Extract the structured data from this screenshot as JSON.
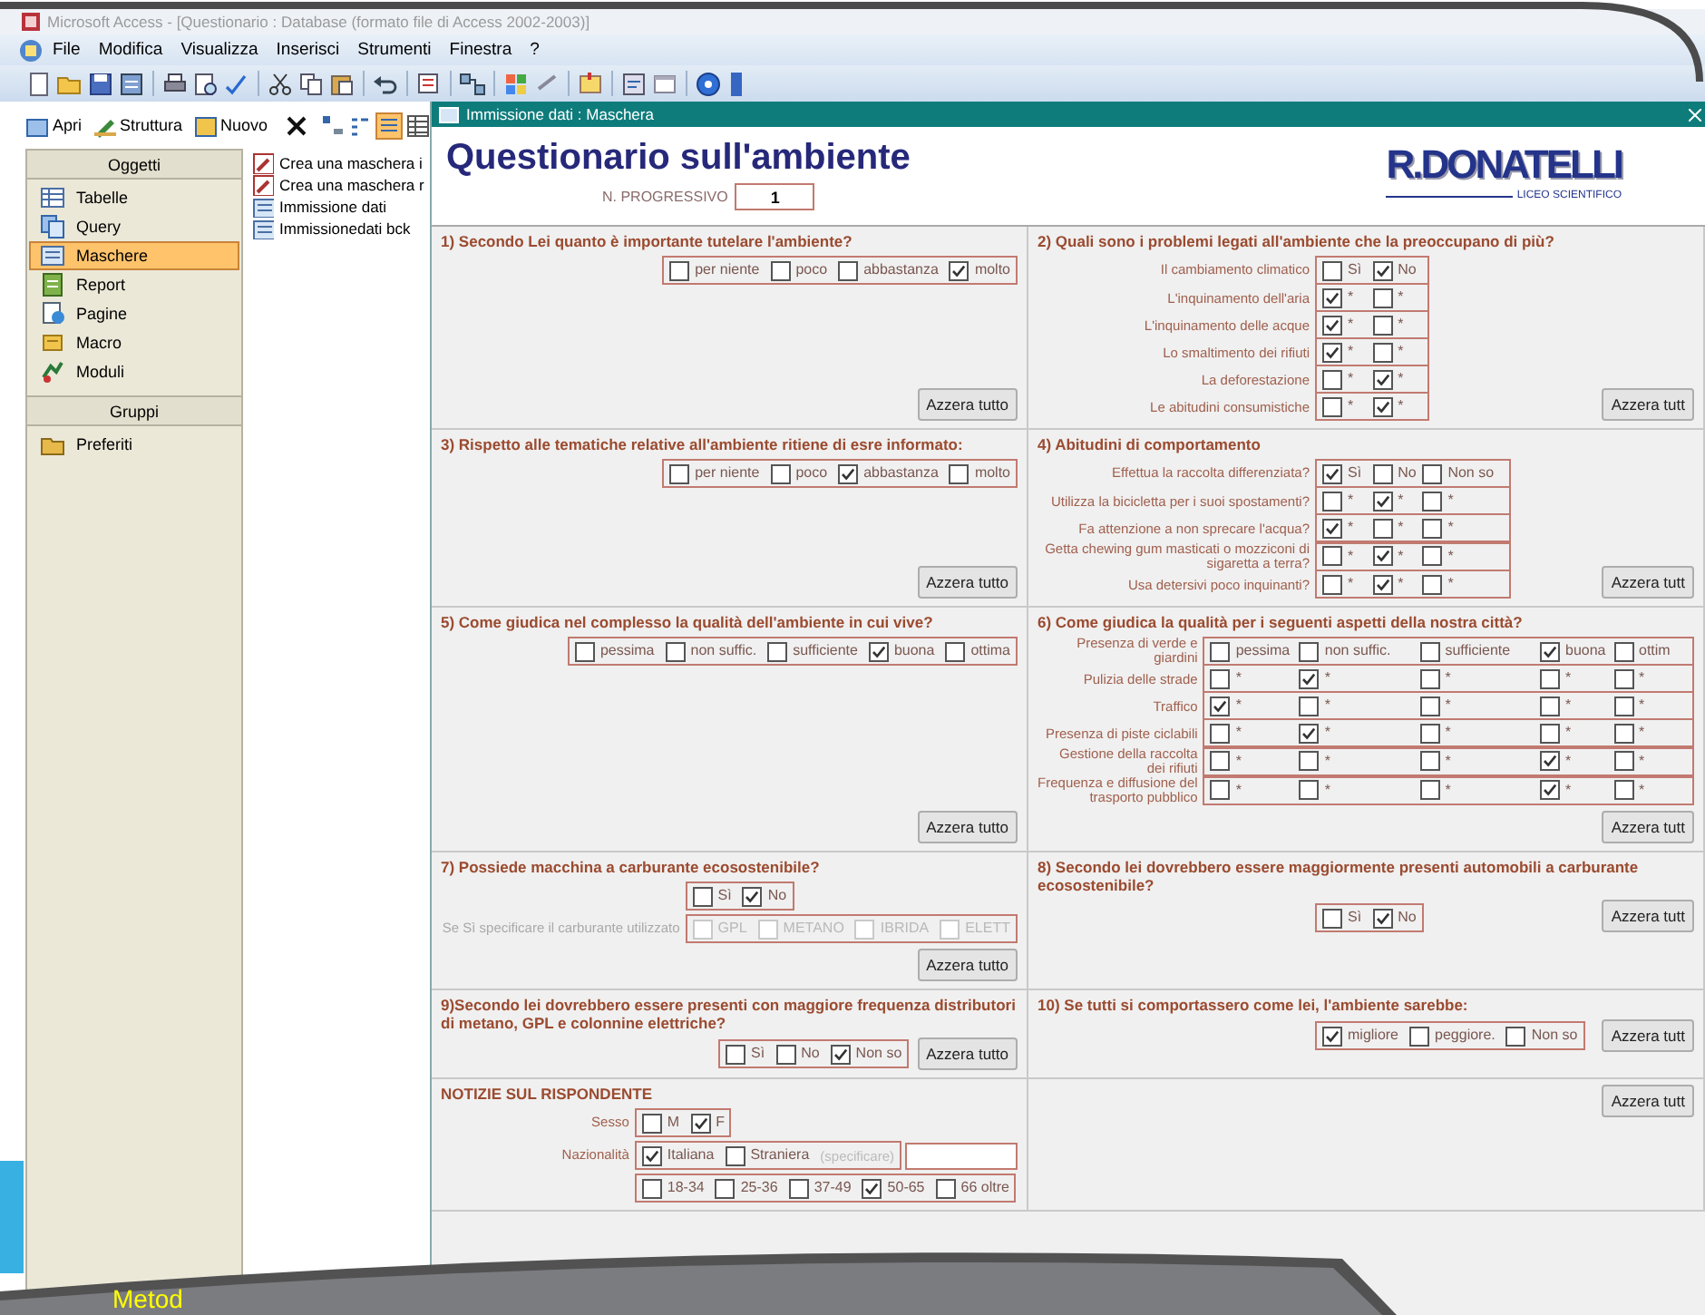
{
  "app": {
    "title": "Microsoft Access - [Questionario : Database (formato file di Access 2002-2003)]"
  },
  "menu": [
    "File",
    "Modifica",
    "Visualizza",
    "Inserisci",
    "Strumenti",
    "Finestra",
    "?"
  ],
  "db_toolbar": [
    "Apri",
    "Struttura",
    "Nuovo"
  ],
  "sidebar": {
    "header": "Oggetti",
    "items": [
      {
        "label": "Tabelle",
        "kind": "table",
        "selected": false
      },
      {
        "label": "Query",
        "kind": "query",
        "selected": false
      },
      {
        "label": "Maschere",
        "kind": "form",
        "selected": true
      },
      {
        "label": "Report",
        "kind": "report",
        "selected": false
      },
      {
        "label": "Pagine",
        "kind": "page",
        "selected": false
      },
      {
        "label": "Macro",
        "kind": "macro",
        "selected": false
      },
      {
        "label": "Moduli",
        "kind": "module",
        "selected": false
      }
    ],
    "groups_header": "Gruppi",
    "groups": [
      {
        "label": "Preferiti",
        "kind": "folder",
        "selected": false
      }
    ]
  },
  "objects": [
    {
      "label": "Crea una maschera i",
      "kind": "wizard"
    },
    {
      "label": "Crea una maschera r",
      "kind": "wizard"
    },
    {
      "label": "Immissione dati",
      "kind": "form"
    },
    {
      "label": "Immissionedati bck",
      "kind": "form"
    }
  ],
  "form": {
    "window_title": "Immissione dati : Maschera",
    "title": "Questionario sull'ambiente",
    "progressivo": {
      "label": "N. PROGRESSIVO",
      "value": "1"
    },
    "logo": {
      "name": "R.DONATELLI",
      "subtitle": "LICEO SCIENTIFICO"
    },
    "sections": [
      {
        "kind": "block",
        "question": "1) Secondo Lei quanto è importante tutelare l'ambiente?",
        "groups": [
          {
            "options": [
              {
                "label": "per niente",
                "checked": false
              },
              {
                "label": "poco",
                "checked": false
              },
              {
                "label": "abbastanza",
                "checked": false
              },
              {
                "label": "molto",
                "checked": true
              }
            ]
          }
        ],
        "reset": "Azzera tutto"
      },
      {
        "kind": "matrix",
        "question": "2) Quali sono i problemi legati all'ambiente che la preoccupano di più?",
        "groups": [
          {
            "label": "Il cambiamento climatico",
            "options": [
              {
                "label": "Sì",
                "checked": false
              },
              {
                "label": "No",
                "checked": true
              }
            ]
          },
          {
            "label": "L'inquinamento dell'aria",
            "options": [
              {
                "label": "*",
                "checked": true
              },
              {
                "label": "*",
                "checked": false
              }
            ]
          },
          {
            "label": "L'inquinamento delle acque",
            "options": [
              {
                "label": "*",
                "checked": true
              },
              {
                "label": "*",
                "checked": false
              }
            ]
          },
          {
            "label": "Lo smaltimento dei rifiuti",
            "options": [
              {
                "label": "*",
                "checked": true
              },
              {
                "label": "*",
                "checked": false
              }
            ]
          },
          {
            "label": "La deforestazione",
            "options": [
              {
                "label": "*",
                "checked": false
              },
              {
                "label": "*",
                "checked": true
              }
            ]
          },
          {
            "label": "Le abitudini consumistiche",
            "options": [
              {
                "label": "*",
                "checked": false
              },
              {
                "label": "*",
                "checked": true
              }
            ]
          }
        ],
        "reset": "Azzera tutt"
      },
      {
        "kind": "block",
        "question": "3) Rispetto alle tematiche relative all'ambiente ritiene di esre informato:",
        "groups": [
          {
            "options": [
              {
                "label": "per niente",
                "checked": false
              },
              {
                "label": "poco",
                "checked": false
              },
              {
                "label": "abbastanza",
                "checked": true
              },
              {
                "label": "molto",
                "checked": false
              }
            ]
          }
        ],
        "reset": "Azzera tutto"
      },
      {
        "kind": "matrix",
        "question": "4) Abitudini di comportamento",
        "groups": [
          {
            "label": "Effettua la raccolta differenziata?",
            "options": [
              {
                "label": "Sì",
                "checked": true
              },
              {
                "label": "No",
                "checked": false
              },
              {
                "label": "Non so",
                "checked": false
              }
            ]
          },
          {
            "label": "Utilizza la bicicletta per i suoi spostamenti?",
            "options": [
              {
                "label": "*",
                "checked": false
              },
              {
                "label": "*",
                "checked": true
              },
              {
                "label": "*",
                "checked": false
              }
            ]
          },
          {
            "label": "Fa attenzione a non sprecare l'acqua?",
            "options": [
              {
                "label": "*",
                "checked": true
              },
              {
                "label": "*",
                "checked": false
              },
              {
                "label": "*",
                "checked": false
              }
            ]
          },
          {
            "label": "Getta chewing gum masticati o mozziconi di sigaretta a terra?",
            "options": [
              {
                "label": "*",
                "checked": false
              },
              {
                "label": "*",
                "checked": true
              },
              {
                "label": "*",
                "checked": false
              }
            ]
          },
          {
            "label": "Usa detersivi poco inquinanti?",
            "options": [
              {
                "label": "*",
                "checked": false
              },
              {
                "label": "*",
                "checked": true
              },
              {
                "label": "*",
                "checked": false
              }
            ]
          }
        ],
        "reset": "Azzera tutt"
      },
      {
        "kind": "block",
        "question": "5) Come giudica nel complesso la qualità dell'ambiente in cui vive?",
        "groups": [
          {
            "options": [
              {
                "label": "pessima",
                "checked": false
              },
              {
                "label": "non suffic.",
                "checked": false
              },
              {
                "label": "sufficiente",
                "checked": false
              },
              {
                "label": "buona",
                "checked": true
              },
              {
                "label": "ottima",
                "checked": false
              }
            ]
          }
        ],
        "reset": "Azzera tutto"
      },
      {
        "kind": "matrix",
        "question": "6) Come giudica la qualità per i seguenti aspetti della nostra città?",
        "groups": [
          {
            "label": "Presenza di verde e giardini",
            "options": [
              {
                "label": "pessima",
                "checked": false
              },
              {
                "label": "non suffic.",
                "checked": false
              },
              {
                "label": "sufficiente",
                "checked": false
              },
              {
                "label": "buona",
                "checked": true
              },
              {
                "label": "ottim",
                "checked": false
              }
            ]
          },
          {
            "label": "Pulizia delle strade",
            "options": [
              {
                "label": "*",
                "checked": false
              },
              {
                "label": "*",
                "checked": true
              },
              {
                "label": "*",
                "checked": false
              },
              {
                "label": "*",
                "checked": false
              },
              {
                "label": "*",
                "checked": false
              }
            ]
          },
          {
            "label": "Traffico",
            "options": [
              {
                "label": "*",
                "checked": true
              },
              {
                "label": "*",
                "checked": false
              },
              {
                "label": "*",
                "checked": false
              },
              {
                "label": "*",
                "checked": false
              },
              {
                "label": "*",
                "checked": false
              }
            ]
          },
          {
            "label": "Presenza di piste ciclabili",
            "options": [
              {
                "label": "*",
                "checked": false
              },
              {
                "label": "*",
                "checked": true
              },
              {
                "label": "*",
                "checked": false
              },
              {
                "label": "*",
                "checked": false
              },
              {
                "label": "*",
                "checked": false
              }
            ]
          },
          {
            "label": "Gestione della raccolta dei rifiuti",
            "options": [
              {
                "label": "*",
                "checked": false
              },
              {
                "label": "*",
                "checked": false
              },
              {
                "label": "*",
                "checked": false
              },
              {
                "label": "*",
                "checked": true
              },
              {
                "label": "*",
                "checked": false
              }
            ]
          },
          {
            "label": "Frequenza e diffusione del trasporto pubblico",
            "options": [
              {
                "label": "*",
                "checked": false
              },
              {
                "label": "*",
                "checked": false
              },
              {
                "label": "*",
                "checked": false
              },
              {
                "label": "*",
                "checked": true
              },
              {
                "label": "*",
                "checked": false
              }
            ]
          }
        ],
        "reset": "Azzera tutt"
      },
      {
        "kind": "block",
        "question": "7) Possiede macchina a carburante ecosostenibile?",
        "groups": [
          {
            "disabled": false,
            "options": [
              {
                "label": "Sì",
                "checked": false
              },
              {
                "label": "No",
                "checked": true
              }
            ]
          },
          {
            "disabled": true,
            "label": "Se Sì specificare il carburante utilizzato",
            "options": [
              {
                "label": "GPL",
                "checked": false
              },
              {
                "label": "METANO",
                "checked": false
              },
              {
                "label": "IBRIDA",
                "checked": false
              },
              {
                "label": "ELETT",
                "checked": false
              }
            ]
          }
        ],
        "reset": "Azzera tutto"
      },
      {
        "kind": "block",
        "question": "8) Secondo lei dovrebbero essere maggiormente presenti automobili a carburante ecosostenibile?",
        "groups": [
          {
            "options": [
              {
                "label": "Sì",
                "checked": false
              },
              {
                "label": "No",
                "checked": true
              }
            ]
          }
        ],
        "reset": "Azzera tutt"
      },
      {
        "kind": "inline",
        "question": "9)Secondo lei dovrebbero essere presenti con maggiore frequenza distributori di metano, GPL e colonnine elettriche?",
        "groups": [
          {
            "options": [
              {
                "label": "Sì",
                "checked": false
              },
              {
                "label": "No",
                "checked": false
              },
              {
                "label": "Non so",
                "checked": true
              }
            ]
          }
        ],
        "reset": "Azzera tutto"
      },
      {
        "kind": "inline",
        "question": "10) Se tutti si comportassero come lei, l'ambiente sarebbe:",
        "groups": [
          {
            "options": [
              {
                "label": "migliore",
                "checked": true
              },
              {
                "label": "peggiore.",
                "checked": false
              },
              {
                "label": "Non so",
                "checked": false
              }
            ]
          }
        ],
        "reset": "Azzera tutt"
      },
      {
        "kind": "block",
        "question": "NOTIZIE SUL RISPONDENTE",
        "groups": [
          {
            "label": "Sesso",
            "options": [
              {
                "label": "M",
                "checked": false
              },
              {
                "label": "F",
                "checked": true
              }
            ]
          },
          {
            "label": "Nazionalità",
            "options": [
              {
                "label": "Italiana",
                "checked": true
              },
              {
                "label": "Straniera",
                "checked": false
              }
            ],
            "note": "(specificare)",
            "has_field": true
          },
          {
            "options": [
              {
                "label": "18-34",
                "checked": false
              },
              {
                "label": "25-36",
                "checked": false
              },
              {
                "label": "37-49",
                "checked": false
              },
              {
                "label": "50-65",
                "checked": true
              },
              {
                "label": "66 oltre",
                "checked": false
              }
            ]
          }
        ]
      },
      {
        "kind": "block",
        "reset": "Azzera tutt"
      }
    ]
  },
  "slide": {
    "banner_title": "Metod"
  }
}
